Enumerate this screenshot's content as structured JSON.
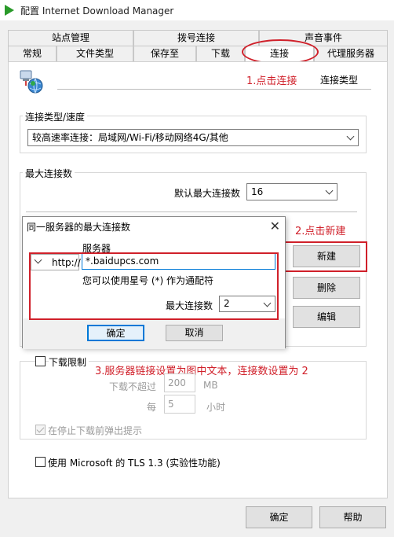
{
  "window": {
    "title": "配置 Internet Download Manager"
  },
  "tabs_back": [
    "站点管理",
    "拨号连接",
    "声音事件"
  ],
  "tabs_front": [
    "常规",
    "文件类型",
    "保存至",
    "下载",
    "连接",
    "代理服务器"
  ],
  "header": {
    "section_title": "连接类型"
  },
  "conn_group": {
    "label": "连接类型/速度",
    "value": "较高速率连接：局域网/Wi-Fi/移动网络4G/其他"
  },
  "max_group": {
    "label": "最大连接数",
    "default_label": "默认最大连接数",
    "default_value": "16",
    "buttons": {
      "new": "新建",
      "delete": "删除",
      "edit": "编辑"
    }
  },
  "download_limit": {
    "checkbox_label": "下载限制",
    "not_exceed_label": "下载不超过",
    "not_exceed_value": "200",
    "unit_mb": "MB",
    "every_label": "每",
    "every_value": "5",
    "unit_hour": "小时",
    "popup_label": "在停止下载前弹出提示"
  },
  "tls": {
    "label": "使用 Microsoft 的 TLS 1.3 (实验性功能)"
  },
  "footer": {
    "ok": "确定",
    "help": "帮助"
  },
  "dialog": {
    "title": "同一服务器的最大连接数",
    "server_label": "服务器",
    "protocol": "http://",
    "server_value": "*.baidupcs.com",
    "hint": "您可以使用星号 (*) 作为通配符",
    "max_conn_label": "最大连接数",
    "max_conn_value": "2",
    "ok": "确定",
    "cancel": "取消"
  },
  "annotations": {
    "step1": "1.点击连接",
    "step2": "2.点击新建",
    "step3": "3.服务器链接设置为图中文本，连接数设置为 2"
  },
  "colors": {
    "annotation": "#d0202a",
    "focus_border": "#0078d7"
  },
  "icons": [
    "idm-app-icon",
    "network-globe-icon",
    "close-icon",
    "chevron-down-icon"
  ]
}
